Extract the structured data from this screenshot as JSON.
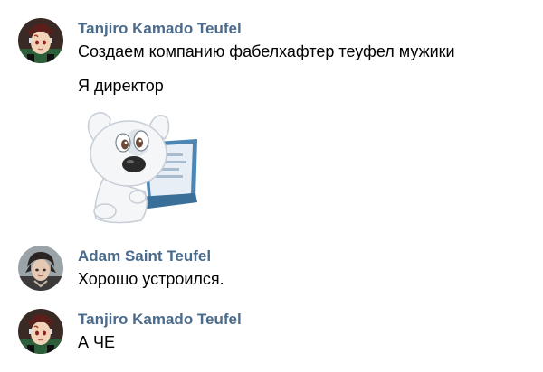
{
  "messages": [
    {
      "author": "Tanjiro Kamado Teufel",
      "avatar_icon": "tanjiro-avatar",
      "lines": [
        "Создаем компанию фабелхафтер теуфел мужики",
        "Я директор"
      ],
      "sticker_icon": "dog-with-laptop-sticker"
    },
    {
      "author": "Adam Saint Teufel",
      "avatar_icon": "adam-avatar",
      "lines": [
        "Хорошо устроился."
      ]
    },
    {
      "author": "Tanjiro Kamado Teufel",
      "avatar_icon": "tanjiro-avatar",
      "lines": [
        "А ЧЕ"
      ]
    }
  ],
  "colors": {
    "author_name": "#4a6b8c",
    "message_text": "#000000",
    "background": "#ffffff"
  }
}
